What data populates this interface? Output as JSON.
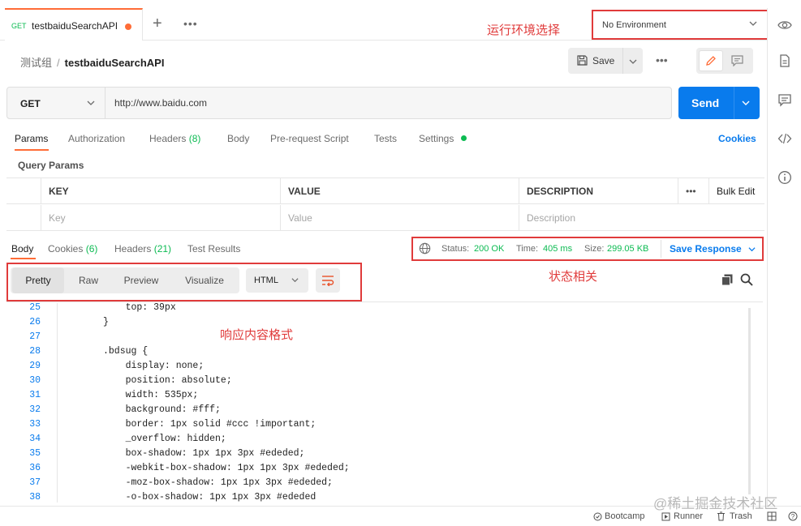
{
  "tabs": [
    {
      "method": "GET",
      "title": "testbaiduSearchAPI"
    }
  ],
  "environment": {
    "selected": "No Environment"
  },
  "annotations": {
    "env": "运行环境选择",
    "status": "状态相关",
    "format": "响应内容格式"
  },
  "breadcrumb": {
    "collection": "测试组",
    "separator": "/",
    "request": "testbaiduSearchAPI"
  },
  "toolbar": {
    "save_label": "Save"
  },
  "request": {
    "method": "GET",
    "url": "http://www.baidu.com",
    "send_label": "Send"
  },
  "request_tabs": [
    {
      "label": "Params"
    },
    {
      "label": "Authorization"
    },
    {
      "label": "Headers",
      "count": "(8)"
    },
    {
      "label": "Body"
    },
    {
      "label": "Pre-request Script"
    },
    {
      "label": "Tests"
    },
    {
      "label": "Settings"
    }
  ],
  "cookies_label": "Cookies",
  "query_params": {
    "title": "Query Params",
    "headers": [
      "KEY",
      "VALUE",
      "DESCRIPTION"
    ],
    "bulk_edit": "Bulk Edit",
    "placeholders": [
      "Key",
      "Value",
      "Description"
    ]
  },
  "response_tabs": [
    {
      "label": "Body"
    },
    {
      "label": "Cookies",
      "count": "(6)"
    },
    {
      "label": "Headers",
      "count": "(21)"
    },
    {
      "label": "Test Results"
    }
  ],
  "response_status": {
    "status_label": "Status:",
    "status_value": "200 OK",
    "time_label": "Time:",
    "time_value": "405 ms",
    "size_label": "Size:",
    "size_value": "299.05 KB",
    "save_response": "Save Response"
  },
  "format": {
    "views": [
      "Pretty",
      "Raw",
      "Preview",
      "Visualize"
    ],
    "active_view": "Pretty",
    "language": "HTML"
  },
  "code_lines": [
    {
      "n": "25",
      "text": "    top: 39px"
    },
    {
      "n": "26",
      "text": "}"
    },
    {
      "n": "27",
      "text": ""
    },
    {
      "n": "28",
      "text": ".bdsug {"
    },
    {
      "n": "29",
      "text": "    display: none;"
    },
    {
      "n": "30",
      "text": "    position: absolute;"
    },
    {
      "n": "31",
      "text": "    width: 535px;"
    },
    {
      "n": "32",
      "text": "    background: #fff;"
    },
    {
      "n": "33",
      "text": "    border: 1px solid #ccc !important;"
    },
    {
      "n": "34",
      "text": "    _overflow: hidden;"
    },
    {
      "n": "35",
      "text": "    box-shadow: 1px 1px 3px #ededed;"
    },
    {
      "n": "36",
      "text": "    -webkit-box-shadow: 1px 1px 3px #ededed;"
    },
    {
      "n": "37",
      "text": "    -moz-box-shadow: 1px 1px 3px #ededed;"
    },
    {
      "n": "38",
      "text": "    -o-box-shadow: 1px 1px 3px #ededed"
    }
  ],
  "footer": {
    "bootcamp": "Bootcamp",
    "runner": "Runner",
    "trash": "Trash"
  },
  "watermark": "@稀土掘金技术社区"
}
